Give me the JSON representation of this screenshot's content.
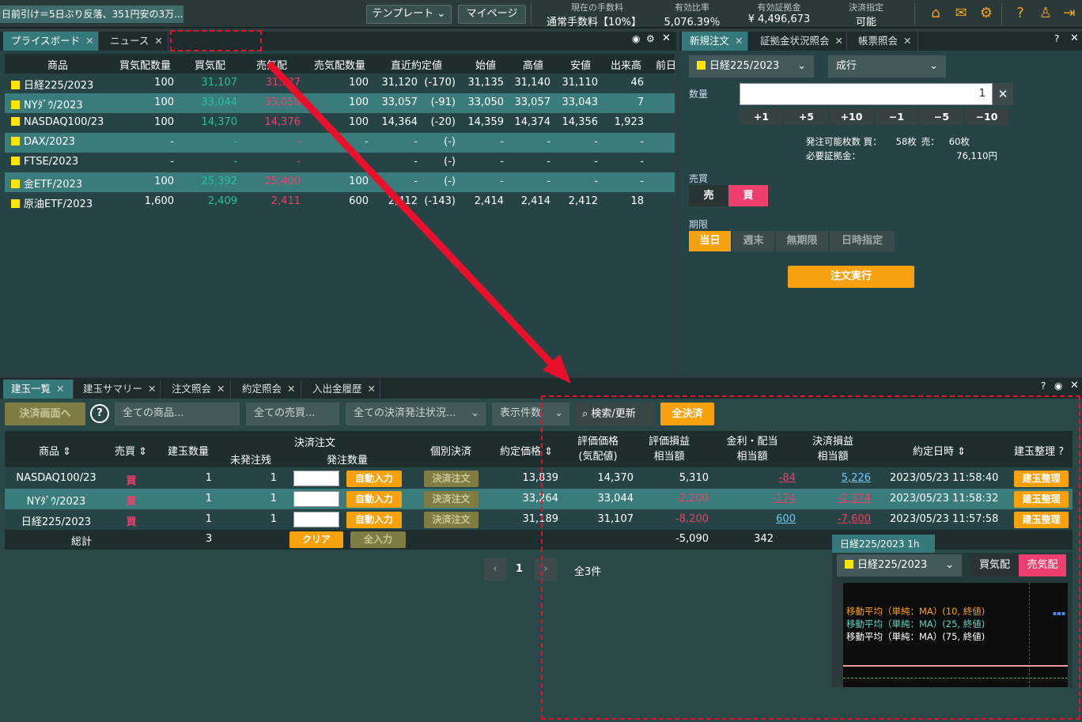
{
  "topbar": {
    "ticker": "日前引け＝5日ぶり反落、351円安の3万...",
    "template_label": "テンプレート",
    "mypage_label": "マイページ",
    "stats": [
      {
        "label": "現在の手数料",
        "value": "通常手数料【10%】"
      },
      {
        "label": "有効比率",
        "value": "5,076.39％"
      },
      {
        "label": "有効証拠金",
        "value": "¥ 4,496,673"
      },
      {
        "label": "決済指定",
        "value": "可能"
      }
    ]
  },
  "price_board": {
    "tabs": [
      "プライスボード",
      "ニュース"
    ],
    "columns": [
      "商品",
      "買気配数量",
      "買気配",
      "売気配",
      "売気配数量",
      "直近約定値",
      "始値",
      "高値",
      "安値",
      "出来高",
      "前日"
    ],
    "rows": [
      {
        "name": "日経225/2023",
        "bq": "100",
        "bid": "31,107",
        "ask": "31,1?7",
        "aq": "100",
        "last": "31,120",
        "chg": "(-170)",
        "open": "31,135",
        "high": "31,140",
        "low": "31,110",
        "vol": "46"
      },
      {
        "name": "NYﾀﾞｳ/2023",
        "bq": "100",
        "bid": "33,044",
        "ask": "33,058",
        "aq": "100",
        "last": "33,057",
        "chg": "(-91)",
        "open": "33,050",
        "high": "33,057",
        "low": "33,043",
        "vol": "7"
      },
      {
        "name": "NASDAQ100/23",
        "bq": "100",
        "bid": "14,370",
        "ask": "14,376",
        "aq": "100",
        "last": "14,364",
        "chg": "(-20)",
        "open": "14,359",
        "high": "14,374",
        "low": "14,356",
        "vol": "1,923"
      },
      {
        "name": "DAX/2023",
        "bq": "-",
        "bid": "-",
        "ask": "-",
        "aq": "-",
        "last": "-",
        "chg": "(-)",
        "open": "-",
        "high": "-",
        "low": "-",
        "vol": "-"
      },
      {
        "name": "FTSE/2023",
        "bq": "-",
        "bid": "-",
        "ask": "-",
        "aq": "",
        "last": "-",
        "chg": "(-)",
        "open": "-",
        "high": "-",
        "low": "-",
        "vol": "-"
      },
      {
        "name": "金ETF/2023",
        "bq": "100",
        "bid": "25,392",
        "ask": "25,400",
        "aq": "100",
        "last": "-",
        "chg": "(-)",
        "open": "-",
        "high": "-",
        "low": "-",
        "vol": "-"
      },
      {
        "name": "原油ETF/2023",
        "bq": "1,600",
        "bid": "2,409",
        "ask": "2,411",
        "aq": "600",
        "last": "2,412",
        "chg": "(-143)",
        "open": "2,414",
        "high": "2,414",
        "low": "2,412",
        "vol": "18"
      }
    ]
  },
  "order": {
    "tabs": [
      "新規注文",
      "証拠金状況照会",
      "帳票照会"
    ],
    "product": "日経225/2023",
    "order_type": "成行",
    "qty_label": "数量",
    "qty_value": "1",
    "steps": [
      "+1",
      "+5",
      "+10",
      "−1",
      "−5",
      "−10"
    ],
    "avail_label": "発注可能枚数 買：",
    "avail_buy": "58枚",
    "avail_sell_label": "売：",
    "avail_sell": "60枚",
    "margin_label": "必要証拠金：",
    "margin_value": "76,110円",
    "side_label": "売買",
    "sell": "売",
    "buy": "買",
    "term_label": "期限",
    "terms": [
      "当日",
      "週末",
      "無期限",
      "日時指定"
    ],
    "submit": "注文実行"
  },
  "positions": {
    "tabs": [
      "建玉一覧",
      "建玉サマリー",
      "注文照会",
      "約定照会",
      "入出金履歴"
    ],
    "settle_screen": "決済画面へ",
    "filter_product": "全ての商品...",
    "filter_side": "全ての売買...",
    "filter_status": "全ての決済発注状況...",
    "filter_count": "表示件数",
    "search": "検索/更新",
    "settle_all": "全決済",
    "headers": {
      "product": "商品",
      "side": "売買",
      "qty": "建玉数量",
      "settle_order": "決済注文",
      "unfilled": "未発注残",
      "order_qty": "発注数量",
      "individual": "個別決済",
      "price": "約定価格",
      "eval1": "評価価格",
      "eval2": "(気配値)",
      "pl1": "評価損益",
      "pl2": "相当額",
      "int1": "金利・配当",
      "int2": "相当額",
      "spl1": "決済損益",
      "spl2": "相当額",
      "date": "約定日時",
      "manage": "建玉整理"
    },
    "rows": [
      {
        "name": "NASDAQ100/23",
        "side": "買",
        "qty": "1",
        "unfilled": "1",
        "auto": "自動入力",
        "settle": "決済注文",
        "price": "13,839",
        "eval": "14,370",
        "pl": "5,310",
        "int": "-84",
        "spl": "5,226",
        "date": "2023/05/23 11:58:40",
        "manage": "建玉整理"
      },
      {
        "name": "NYﾀﾞｳ/2023",
        "side": "買",
        "qty": "1",
        "unfilled": "1",
        "auto": "自動入力",
        "settle": "決済注文",
        "price": "33,264",
        "eval": "33,044",
        "pl": "-2,200",
        "int": "-174",
        "spl": "-2,374",
        "date": "2023/05/23 11:58:32",
        "manage": "建玉整理"
      },
      {
        "name": "日経225/2023",
        "side": "買",
        "qty": "1",
        "unfilled": "1",
        "auto": "自動入力",
        "settle": "決済注文",
        "price": "31,189",
        "eval": "31,107",
        "pl": "-8,200",
        "int": "600",
        "spl": "-7,600",
        "date": "2023/05/23 11:57:58",
        "manage": "建玉整理"
      }
    ],
    "total_label": "総計",
    "total_qty": "3",
    "clear": "クリア",
    "fill_all": "全入力",
    "total_pl": "-5,090",
    "total_int": "342",
    "page": "1",
    "count": "全3件"
  },
  "chart_popup": {
    "tab": "日経225/2023 1h",
    "product": "日経225/2023",
    "bid_btn": "買気配",
    "ask_btn": "売気配",
    "ma": [
      "移動平均（単純：MA）(10, 終値)",
      "移動平均（単純：MA）(25, 終値)",
      "移動平均（単純：MA）(75, 終値)"
    ]
  },
  "colors": {
    "accent": "#f7a10f",
    "up": "#26c29a",
    "down": "#ef3e6a",
    "highlight": "#e8102a"
  }
}
